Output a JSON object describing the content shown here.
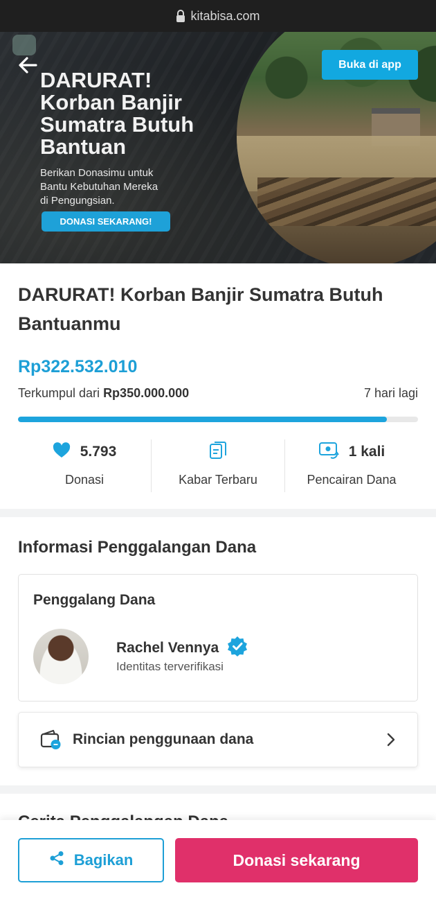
{
  "browser": {
    "url": "kitabisa.com"
  },
  "banner": {
    "headline_line1": "DARURAT!",
    "headline_line2": "Korban Banjir",
    "headline_line3": "Sumatra Butuh",
    "headline_line4": "Bantuan",
    "sub_line1": "Berikan Donasimu untuk",
    "sub_line2": "Bantu Kebutuhan Mereka",
    "sub_line3": "di Pengungsian.",
    "cta_label": "DONASI SEKARANG!",
    "open_app_label": "Buka di app"
  },
  "campaign": {
    "title": "DARURAT! Korban Banjir Sumatra Butuh Bantuanmu",
    "collected_amount": "Rp322.532.010",
    "target_prefix": "Terkumpul dari",
    "target_amount": "Rp350.000.000",
    "days_left": "7 hari lagi",
    "progress_fraction": 0.9215
  },
  "stats": [
    {
      "icon": "heart-icon",
      "value": "5.793",
      "label": "Donasi"
    },
    {
      "icon": "news-icon",
      "value": "",
      "label": "Kabar Terbaru"
    },
    {
      "icon": "disbursement-icon",
      "value": "1 kali",
      "label": "Pencairan Dana"
    }
  ],
  "fundraiser": {
    "section_title": "Informasi Penggalangan Dana",
    "card_title": "Penggalang Dana",
    "name": "Rachel Vennya",
    "status": "Identitas terverifikasi"
  },
  "usage": {
    "label": "Rincian penggunaan dana"
  },
  "next_section_title": "Cerita Penggalangan Dana",
  "actions": {
    "share_label": "Bagikan",
    "donate_label": "Donasi sekarang"
  },
  "colors": {
    "accent_blue": "#1d9fd6",
    "donate_pink": "#e0306a",
    "verified_blue": "#1da4dd"
  }
}
